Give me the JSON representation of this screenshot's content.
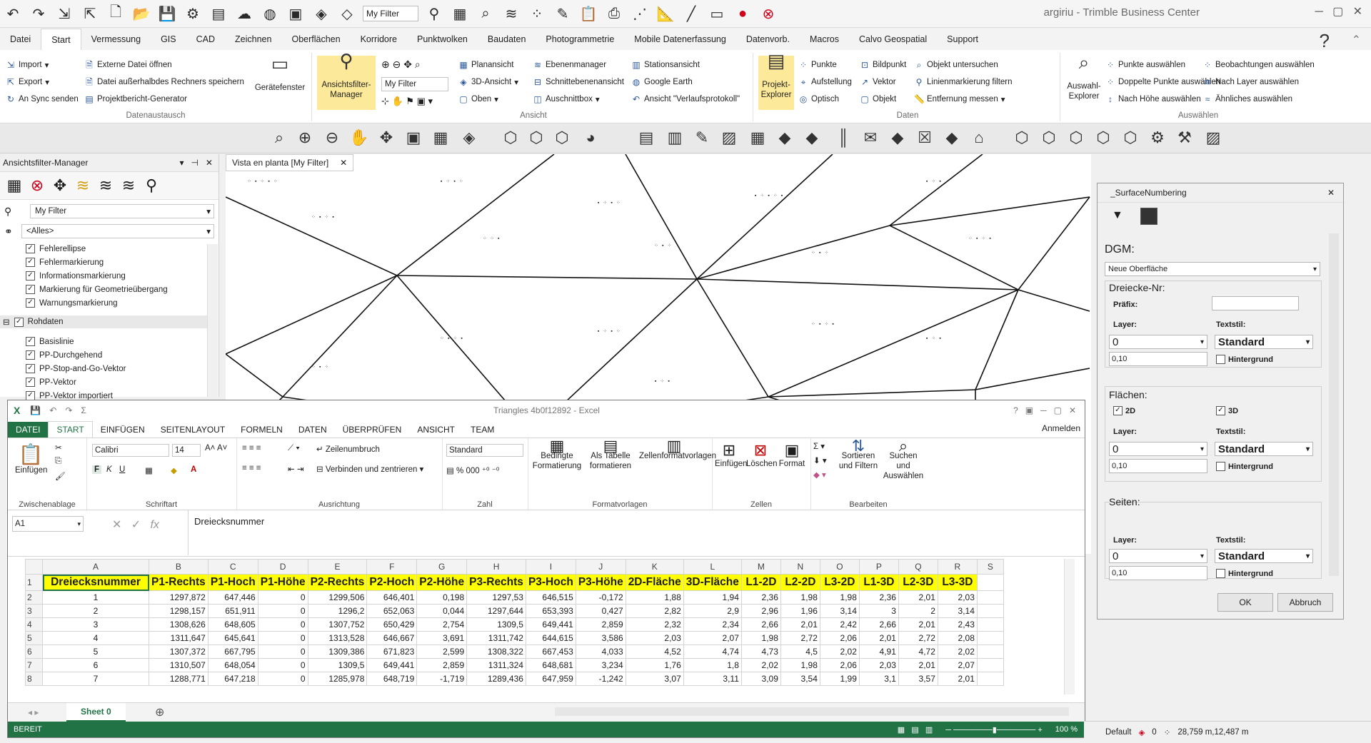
{
  "app": {
    "title": "argiriu - Trimble Business Center",
    "qat_filter": "My Filter"
  },
  "tabs": [
    "Datei",
    "Start",
    "Vermessung",
    "GIS",
    "CAD",
    "Zeichnen",
    "Oberflächen",
    "Korridore",
    "Punktwolken",
    "Baudaten",
    "Photogrammetrie",
    "Mobile Datenerfassung",
    "Datenvorb.",
    "Macros",
    "Calvo Geospatial",
    "Support"
  ],
  "ribbon": {
    "datenaustausch": {
      "import": "Import",
      "export": "Export",
      "sync": "An Sync senden",
      "ext_open": "Externe Datei öffnen",
      "ext_save": "Datei außerhalbdes Rechners speichern",
      "report_gen": "Projektbericht-Generator",
      "devices": "Gerätefenster",
      "label": "Datenaustausch"
    },
    "ansicht": {
      "filter_manager": "Ansichtsfilter-Manager",
      "filter_value": "My Filter",
      "planansicht": "Planansicht",
      "ansicht3d": "3D-Ansicht",
      "oben": "Oben",
      "ebenenmanager": "Ebenenmanager",
      "schnittebenen": "Schnittebenenansicht",
      "auschnittbox": "Auschnittbox",
      "stationsansicht": "Stationsansicht",
      "google_earth": "Google Earth",
      "verlauf": "Ansicht \"Verlaufsprotokoll\"",
      "label": "Ansicht"
    },
    "daten": {
      "projekt_explorer": "Projekt-Explorer",
      "punkte": "Punkte",
      "aufstellung": "Aufstellung",
      "optisch": "Optisch",
      "bildpunkt": "Bildpunkt",
      "vektor": "Vektor",
      "objekt": "Objekt",
      "untersuchen": "Objekt untersuchen",
      "linienmarkierung": "Linienmarkierung filtern",
      "entfernung": "Entfernung messen",
      "label": "Daten"
    },
    "auswaehlen": {
      "explorer": "Auswahl-Explorer",
      "punkte": "Punkte auswählen",
      "doppelte": "Doppelte Punkte auswählen",
      "hoehe": "Nach Höhe auswählen",
      "beobachtungen": "Beobachtungen auswählen",
      "layer": "Nach Layer auswählen",
      "aehnliches": "Ähnliches auswählen",
      "label": "Auswählen"
    }
  },
  "left_panel": {
    "title": "Ansichtsfilter-Manager",
    "filter": "My Filter",
    "scope": "<Alles>",
    "items_a": [
      "Fehlerellipse",
      "Fehlermarkierung",
      "Informationsmarkierung",
      "Markierung für Geometrieübergang",
      "Warnungsmarkierung"
    ],
    "group": "Rohdaten",
    "items_b": [
      "Basislinie",
      "PP-Durchgehend",
      "PP-Stop-and-Go-Vektor",
      "PP-Vektor",
      "PP-Vektor importiert"
    ]
  },
  "plan_tab": "Vista en planta [My Filter]",
  "dialog": {
    "title": "_SurfaceNumbering",
    "dgm_label": "DGM:",
    "dgm_value": "Neue Oberfläche",
    "section_dreiecke": "Dreiecke-Nr:",
    "praefix": "Präfix:",
    "layer": "Layer:",
    "textstil": "Textstil:",
    "layer_value": "0",
    "style_value": "Standard",
    "size_value": "0,10",
    "hintergrund": "Hintergrund",
    "section_flaechen": "Flächen:",
    "opt_2d": "2D",
    "opt_3d": "3D",
    "section_seiten": "Seiten:",
    "ok": "OK",
    "cancel": "Abbruch"
  },
  "excel": {
    "title": "Triangles 4b0f12892 - Excel",
    "signin": "Anmelden",
    "tabs": [
      "DATEI",
      "START",
      "EINFÜGEN",
      "SEITENLAYOUT",
      "FORMELN",
      "DATEN",
      "ÜBERPRÜFEN",
      "ANSICHT",
      "TEAM"
    ],
    "font": "Calibri",
    "font_size": "14",
    "number_format": "Standard",
    "paste": "Einfügen",
    "wrap": "Zeilenumbruch",
    "merge": "Verbinden und zentrieren",
    "cond_fmt": "Bedingte Formatierung",
    "as_table": "Als Tabelle formatieren",
    "cell_styles": "Zellenformatvorlagen",
    "insert": "Einfügen",
    "delete": "Löschen",
    "format": "Format",
    "sort": "Sortieren und Filtern",
    "find": "Suchen und Auswählen",
    "groups": [
      "Zwischenablage",
      "Schriftart",
      "Ausrichtung",
      "Zahl",
      "Formatvorlagen",
      "Zellen",
      "Bearbeiten"
    ],
    "name_box": "A1",
    "formula": "Dreiecksnummer",
    "columns": [
      "A",
      "B",
      "C",
      "D",
      "E",
      "F",
      "G",
      "H",
      "I",
      "J",
      "K",
      "L",
      "M",
      "N",
      "O",
      "P",
      "Q",
      "R",
      "S"
    ],
    "headers": [
      "Dreiecksnummer",
      "P1-Rechts",
      "P1-Hoch",
      "P1-Höhe",
      "P2-Rechts",
      "P2-Hoch",
      "P2-Höhe",
      "P3-Rechts",
      "P3-Hoch",
      "P3-Höhe",
      "2D-Fläche",
      "3D-Fläche",
      "L1-2D",
      "L2-2D",
      "L3-2D",
      "L1-3D",
      "L2-3D",
      "L3-3D"
    ],
    "rows": [
      [
        "1",
        "1297,872",
        "647,446",
        "0",
        "1299,506",
        "646,401",
        "0,198",
        "1297,53",
        "646,515",
        "-0,172",
        "1,88",
        "1,94",
        "2,36",
        "1,98",
        "1,98",
        "2,36",
        "2,01",
        "2,03"
      ],
      [
        "2",
        "1298,157",
        "651,911",
        "0",
        "1296,2",
        "652,063",
        "0,044",
        "1297,644",
        "653,393",
        "0,427",
        "2,82",
        "2,9",
        "2,96",
        "1,96",
        "3,14",
        "3",
        "2",
        "3,14"
      ],
      [
        "3",
        "1308,626",
        "648,605",
        "0",
        "1307,752",
        "650,429",
        "2,754",
        "1309,5",
        "649,441",
        "2,859",
        "2,32",
        "2,34",
        "2,66",
        "2,01",
        "2,42",
        "2,66",
        "2,01",
        "2,43"
      ],
      [
        "4",
        "1311,647",
        "645,641",
        "0",
        "1313,528",
        "646,667",
        "3,691",
        "1311,742",
        "644,615",
        "3,586",
        "2,03",
        "2,07",
        "1,98",
        "2,72",
        "2,06",
        "2,01",
        "2,72",
        "2,08"
      ],
      [
        "5",
        "1307,372",
        "667,795",
        "0",
        "1309,386",
        "671,823",
        "2,599",
        "1308,322",
        "667,453",
        "4,033",
        "4,52",
        "4,74",
        "4,73",
        "4,5",
        "2,02",
        "4,91",
        "4,72",
        "2,02"
      ],
      [
        "6",
        "1310,507",
        "648,054",
        "0",
        "1309,5",
        "649,441",
        "2,859",
        "1311,324",
        "648,681",
        "3,234",
        "1,76",
        "1,8",
        "2,02",
        "1,98",
        "2,06",
        "2,03",
        "2,01",
        "2,07"
      ],
      [
        "7",
        "1288,771",
        "647,218",
        "0",
        "1285,978",
        "648,719",
        "-1,719",
        "1289,436",
        "647,959",
        "-1,242",
        "3,07",
        "3,11",
        "3,09",
        "3,54",
        "1,99",
        "3,1",
        "3,57",
        "2,01"
      ]
    ],
    "row_numbers": [
      "1",
      "2",
      "3",
      "4",
      "5",
      "6",
      "7",
      "8"
    ],
    "sheet": "Sheet 0",
    "status": "BEREIT",
    "zoom": "100 %"
  },
  "statusbar": {
    "style": "Default",
    "count": "0",
    "coords": "28,759 m,12,487 m"
  }
}
